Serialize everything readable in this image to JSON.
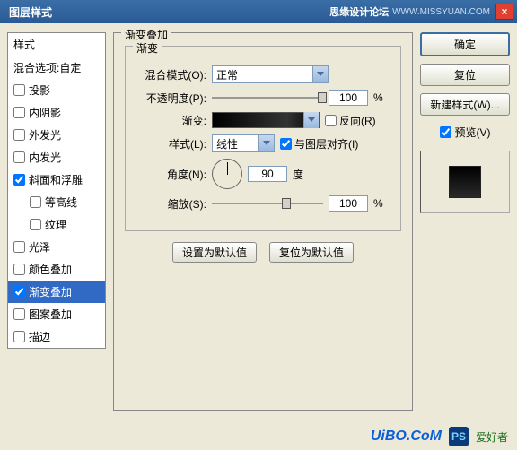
{
  "titlebar": {
    "title": "图层样式",
    "logo": "思缘设计论坛",
    "url": "WWW.MISSYUAN.COM"
  },
  "leftPanel": {
    "header": "样式",
    "blendHeader": "混合选项:自定",
    "items": [
      {
        "label": "投影",
        "checked": false,
        "sub": false
      },
      {
        "label": "内阴影",
        "checked": false,
        "sub": false
      },
      {
        "label": "外发光",
        "checked": false,
        "sub": false
      },
      {
        "label": "内发光",
        "checked": false,
        "sub": false
      },
      {
        "label": "斜面和浮雕",
        "checked": true,
        "sub": false
      },
      {
        "label": "等高线",
        "checked": false,
        "sub": true
      },
      {
        "label": "纹理",
        "checked": false,
        "sub": true
      },
      {
        "label": "光泽",
        "checked": false,
        "sub": false
      },
      {
        "label": "颜色叠加",
        "checked": false,
        "sub": false
      },
      {
        "label": "渐变叠加",
        "checked": true,
        "sub": false,
        "selected": true
      },
      {
        "label": "图案叠加",
        "checked": false,
        "sub": false
      },
      {
        "label": "描边",
        "checked": false,
        "sub": false
      }
    ]
  },
  "middle": {
    "groupTitle": "渐变叠加",
    "innerTitle": "渐变",
    "blendModeLabel": "混合模式(O):",
    "blendModeValue": "正常",
    "opacityLabel": "不透明度(P):",
    "opacityValue": "100",
    "percent": "%",
    "gradientLabel": "渐变:",
    "reverseLabel": "反向(R)",
    "styleLabel": "样式(L):",
    "styleValue": "线性",
    "alignLabel": "与图层对齐(I)",
    "angleLabel": "角度(N):",
    "angleValue": "90",
    "degree": "度",
    "scaleLabel": "缩放(S):",
    "scaleValue": "100",
    "btnDefault": "设置为默认值",
    "btnReset": "复位为默认值"
  },
  "right": {
    "ok": "确定",
    "cancel": "复位",
    "newStyle": "新建样式(W)...",
    "previewLabel": "预览(V)"
  },
  "footer": {
    "uibo": "UiBO.CoM",
    "ps": "PS",
    "ahz": "爱好者"
  }
}
